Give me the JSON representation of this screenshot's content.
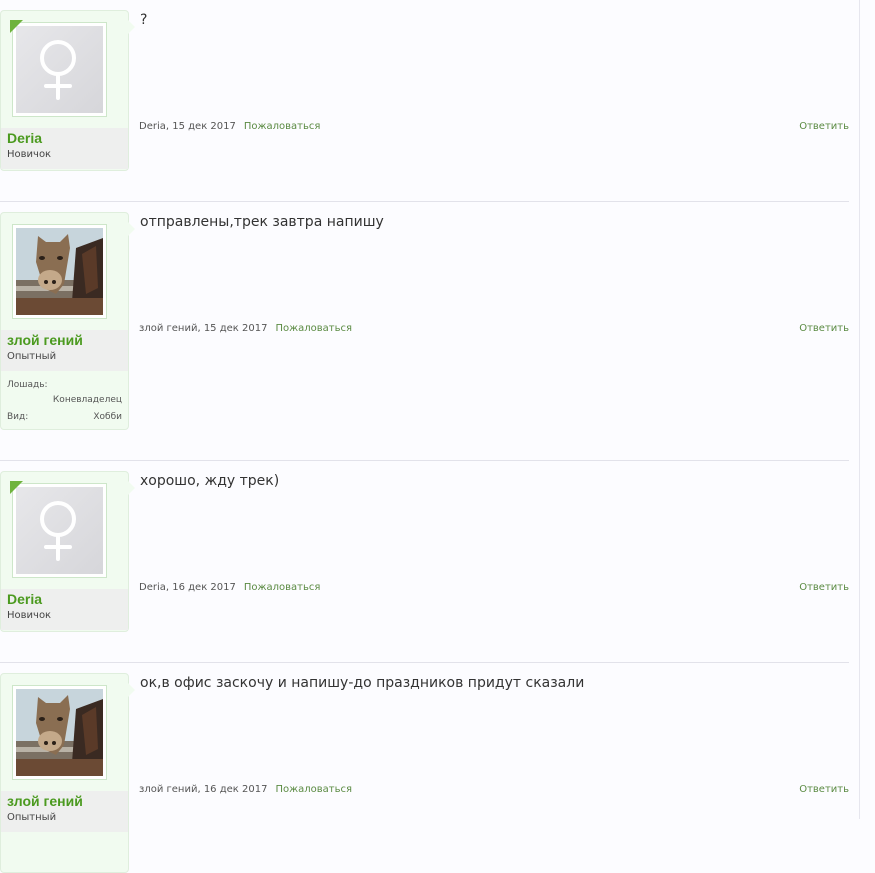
{
  "posts": [
    {
      "author": "Deria",
      "author_title": "Новичок",
      "avatar": "female-symbol-icon",
      "message": "?",
      "date": "15 дек 2017",
      "report_label": "Пожаловаться",
      "reply_label": "Ответить"
    },
    {
      "author": "злой гений",
      "author_title": "Опытный",
      "avatar": "horse-photo",
      "fields": [
        {
          "label": "Лошадь:",
          "value": "Коневладелец"
        },
        {
          "label": "Вид:",
          "value": "Хобби"
        }
      ],
      "message": "отправлены,трек завтра напишу",
      "date": "15 дек 2017",
      "report_label": "Пожаловаться",
      "reply_label": "Ответить"
    },
    {
      "author": "Deria",
      "author_title": "Новичок",
      "avatar": "female-symbol-icon",
      "message": "хорошо, жду трек)",
      "date": "16 дек 2017",
      "report_label": "Пожаловаться",
      "reply_label": "Ответить"
    },
    {
      "author": "злой гений",
      "author_title": "Опытный",
      "avatar": "horse-photo",
      "message": "ок,в офис заскочу и напишу-до праздников придут сказали",
      "date": "16 дек 2017",
      "report_label": "Пожаловаться",
      "reply_label": "Ответить"
    }
  ],
  "colors": {
    "accent_green": "#4b9a1f",
    "link_green": "#5a8a42",
    "userinfo_bg": "#f1fbf0"
  }
}
